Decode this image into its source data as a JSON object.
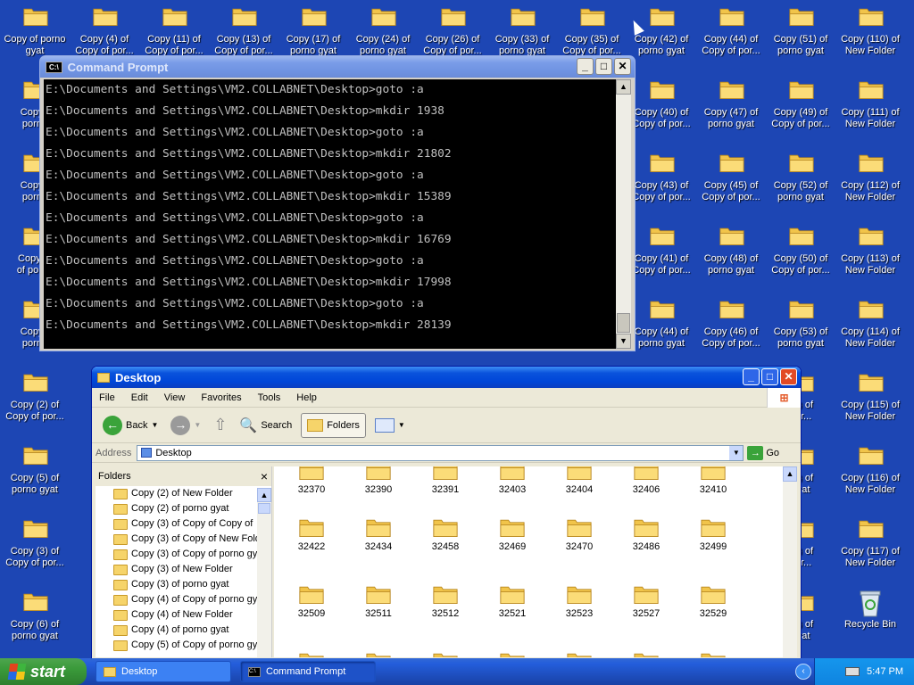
{
  "desktop": {
    "icons_row1": [
      {
        "line1": "Copy of porno",
        "line2": "gyat"
      },
      {
        "line1": "Copy (4) of",
        "line2": "Copy of por..."
      },
      {
        "line1": "Copy (11) of",
        "line2": "Copy of por..."
      },
      {
        "line1": "Copy (13) of",
        "line2": "Copy of por..."
      },
      {
        "line1": "Copy (17) of",
        "line2": "porno gyat"
      },
      {
        "line1": "Copy (24) of",
        "line2": "porno gyat"
      },
      {
        "line1": "Copy (26) of",
        "line2": "Copy of por..."
      },
      {
        "line1": "Copy (33) of",
        "line2": "porno gyat"
      },
      {
        "line1": "Copy (35) of",
        "line2": "Copy of por..."
      },
      {
        "line1": "Copy (42) of",
        "line2": "porno gyat"
      },
      {
        "line1": "Copy (44) of",
        "line2": "Copy of por..."
      },
      {
        "line1": "Copy (51) of",
        "line2": "porno gyat"
      },
      {
        "line1": "Copy (110) of",
        "line2": "New Folder"
      }
    ],
    "right_icons": [
      {
        "line1": "Copy (40) of",
        "line2": "Copy of por..."
      },
      {
        "line1": "Copy (47) of",
        "line2": "porno gyat"
      },
      {
        "line1": "Copy (49) of",
        "line2": "Copy of por..."
      },
      {
        "line1": "Copy (111) of",
        "line2": "New Folder"
      },
      {
        "line1": "Copy (43) of",
        "line2": "Copy of por..."
      },
      {
        "line1": "Copy (45) of",
        "line2": "Copy of por..."
      },
      {
        "line1": "Copy (52) of",
        "line2": "porno gyat"
      },
      {
        "line1": "Copy (112) of",
        "line2": "New Folder"
      },
      {
        "line1": "Copy (41) of",
        "line2": "Copy of por..."
      },
      {
        "line1": "Copy (48) of",
        "line2": "porno gyat"
      },
      {
        "line1": "Copy (50) of",
        "line2": "Copy of por..."
      },
      {
        "line1": "Copy (113) of",
        "line2": "New Folder"
      },
      {
        "line1": "Copy (44) of",
        "line2": "porno gyat"
      },
      {
        "line1": "Copy (46) of",
        "line2": "Copy of por..."
      },
      {
        "line1": "Copy (53) of",
        "line2": "porno gyat"
      },
      {
        "line1": "Copy (114) of",
        "line2": "New Folder"
      },
      {
        "line1": "51) of",
        "line2": "por..."
      },
      {
        "line1": "Copy (115) of",
        "line2": "New Folder"
      },
      {
        "line1": "54) of",
        "line2": "gyat"
      },
      {
        "line1": "Copy (116) of",
        "line2": "New Folder"
      },
      {
        "line1": "52) of",
        "line2": "por..."
      },
      {
        "line1": "Copy (117) of",
        "line2": "New Folder"
      },
      {
        "line1": "55) of",
        "line2": "gyat"
      }
    ],
    "left_icons": [
      {
        "line1": "Copy (",
        "line2": "porno"
      },
      {
        "line1": "Copy (",
        "line2": "porno"
      },
      {
        "line1": "Copy of",
        "line2": "of porno"
      },
      {
        "line1": "Copy (",
        "line2": "porno"
      },
      {
        "line1": "Copy (2) of",
        "line2": "Copy of por..."
      },
      {
        "line1": "Copy (5) of",
        "line2": "porno gyat"
      },
      {
        "line1": "Copy (3) of",
        "line2": "Copy of por..."
      },
      {
        "line1": "Copy (6) of",
        "line2": "porno gyat"
      }
    ],
    "left_col2_icons": [
      {
        "line1": "Co",
        "line2": "Co"
      },
      {
        "line1": "Co",
        "line2": "Co"
      },
      {
        "line1": "Co",
        "line2": "Co"
      }
    ],
    "recycle_bin": "Recycle Bin"
  },
  "cmd": {
    "title": "Command Prompt",
    "icon_text": "C:\\",
    "lines": [
      "E:\\Documents and Settings\\VM2.COLLABNET\\Desktop>goto :a",
      "E:\\Documents and Settings\\VM2.COLLABNET\\Desktop>mkdir 1938",
      "E:\\Documents and Settings\\VM2.COLLABNET\\Desktop>goto :a",
      "E:\\Documents and Settings\\VM2.COLLABNET\\Desktop>mkdir 21802",
      "E:\\Documents and Settings\\VM2.COLLABNET\\Desktop>goto :a",
      "E:\\Documents and Settings\\VM2.COLLABNET\\Desktop>mkdir 15389",
      "E:\\Documents and Settings\\VM2.COLLABNET\\Desktop>goto :a",
      "E:\\Documents and Settings\\VM2.COLLABNET\\Desktop>mkdir 16769",
      "E:\\Documents and Settings\\VM2.COLLABNET\\Desktop>goto :a",
      "E:\\Documents and Settings\\VM2.COLLABNET\\Desktop>mkdir 17998",
      "E:\\Documents and Settings\\VM2.COLLABNET\\Desktop>goto :a",
      "E:\\Documents and Settings\\VM2.COLLABNET\\Desktop>mkdir 28139"
    ]
  },
  "explorer": {
    "title": "Desktop",
    "menu": [
      "File",
      "Edit",
      "View",
      "Favorites",
      "Tools",
      "Help"
    ],
    "toolbar": {
      "back": "Back",
      "search": "Search",
      "folders": "Folders"
    },
    "address_label": "Address",
    "address_value": "Desktop",
    "go_label": "Go",
    "folders_pane_title": "Folders",
    "tree": [
      "Copy (2) of New Folder",
      "Copy (2) of porno gyat",
      "Copy (3) of Copy of Copy of",
      "Copy (3) of Copy of New Fold",
      "Copy (3) of Copy of porno gy",
      "Copy (3) of New Folder",
      "Copy (3) of porno gyat",
      "Copy (4) of Copy of porno gy",
      "Copy (4) of New Folder",
      "Copy (4) of porno gyat",
      "Copy (5) of Copy of porno gy"
    ],
    "files_row1": [
      "32370",
      "32390",
      "32391",
      "32403",
      "32404",
      "32406",
      "32410"
    ],
    "files_row2": [
      "32422",
      "32434",
      "32458",
      "32469",
      "32470",
      "32486",
      "32499"
    ],
    "files_row3": [
      "32509",
      "32511",
      "32512",
      "32521",
      "32523",
      "32527",
      "32529"
    ]
  },
  "taskbar": {
    "start": "start",
    "tasks": [
      {
        "label": "Desktop"
      },
      {
        "label": "Command Prompt"
      }
    ],
    "clock": "5:47 PM"
  },
  "colors": {
    "desktop_bg": "#1d46b4",
    "title_active": "#0046d8",
    "folder": "#f6d46a"
  }
}
